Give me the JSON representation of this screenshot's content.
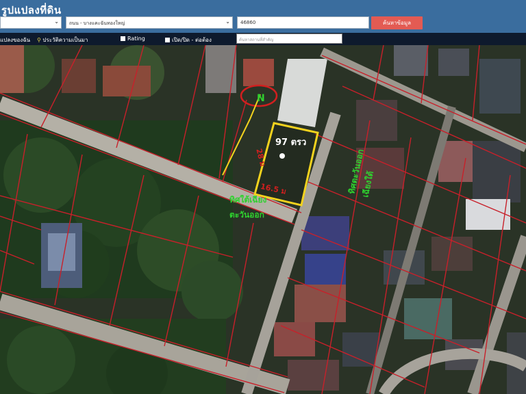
{
  "header": {
    "title": "รูปแปลงที่ดิน",
    "select_1": "",
    "select_2": "ถนน - บางแคะฉันทองใหญ่",
    "postcode": "46860",
    "search_button": "ค้นหาข้อมูล"
  },
  "toolbar": {
    "item_1": "แปลงของฉัน",
    "item_2": "ประวัติความเป็นมา",
    "item_3": "Rating",
    "item_4": "เปิด/ปิด - ต่อต้อง",
    "search_placeholder": "ค้นหาสถานที่สำคัญ"
  },
  "map": {
    "north_label": "N",
    "area_label": "97 ตรว",
    "side_label": "28 ม",
    "bottom_label": "16.5 ม",
    "direction_southeast": "ทิศตะวันออกเฉียงใต้",
    "direction_southeast_line1": "ทิศตะวันออก",
    "direction_southeast_line2": "เฉียงใต้",
    "direction_northeast_line1": "ทิศใต้เฉียง",
    "direction_northeast_line2": "ตะวันออก",
    "colors": {
      "parcel_border": "#f2d21e",
      "land_lines": "#c8202a",
      "direction_text": "#2fd12f",
      "marker_circle": "#d11f1f"
    }
  }
}
